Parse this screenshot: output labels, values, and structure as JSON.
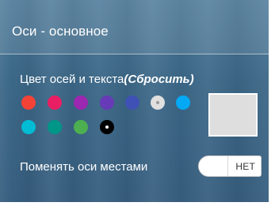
{
  "panel": {
    "title": "Оси - основное"
  },
  "axis_color": {
    "label": "Цвет осей и текста",
    "reset_label": "(Сбросить)",
    "swatches": [
      {
        "name": "red",
        "color": "#f44336"
      },
      {
        "name": "pink",
        "color": "#e91e63"
      },
      {
        "name": "purple",
        "color": "#9c27b0"
      },
      {
        "name": "deep-purple",
        "color": "#673ab7"
      },
      {
        "name": "indigo",
        "color": "#3f51b5"
      },
      {
        "name": "light-gray",
        "color": "#e0e0e0",
        "selected": true
      },
      {
        "name": "light-blue",
        "color": "#03a9f4"
      },
      {
        "name": "cyan",
        "color": "#00bcd4"
      },
      {
        "name": "teal",
        "color": "#009688"
      },
      {
        "name": "green",
        "color": "#4caf50"
      },
      {
        "name": "black",
        "color": "#000000"
      }
    ],
    "preview_color": "#dedede"
  },
  "swap_axes": {
    "label": "Поменять оси местами",
    "toggle_text": "НЕТ",
    "enabled": false
  }
}
